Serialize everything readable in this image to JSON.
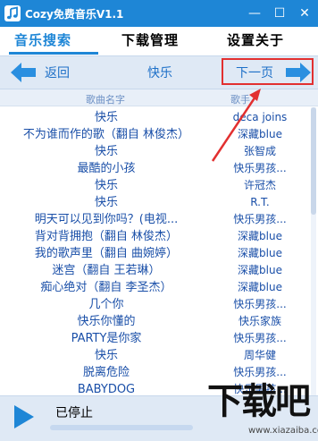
{
  "window": {
    "title": "Cozy免费音乐V1.1",
    "minimize_label": "—",
    "maximize_label": "☐",
    "close_label": "✕"
  },
  "tabs": [
    {
      "label": "音乐搜索",
      "active": true
    },
    {
      "label": "下载管理",
      "active": false
    },
    {
      "label": "设置关于",
      "active": false
    }
  ],
  "nav": {
    "back_label": "返回",
    "title": "快乐",
    "next_label": "下一页"
  },
  "list": {
    "headers": {
      "song": "歌曲名字",
      "artist": "歌手"
    },
    "rows": [
      {
        "song": "快乐",
        "artist": "deca joins"
      },
      {
        "song": "不为谁而作的歌（翻自 林俊杰）",
        "artist": "深藏blue"
      },
      {
        "song": "快乐",
        "artist": "张智成"
      },
      {
        "song": "最酷的小孩",
        "artist": "快乐男孩..."
      },
      {
        "song": "快乐",
        "artist": "许冠杰"
      },
      {
        "song": "快乐",
        "artist": "R.T."
      },
      {
        "song": "明天可以见到你吗？(电视...",
        "artist": "快乐男孩..."
      },
      {
        "song": "背对背拥抱（翻自 林俊杰）",
        "artist": "深藏blue"
      },
      {
        "song": "我的歌声里（翻自 曲婉婷）",
        "artist": "深藏blue"
      },
      {
        "song": "迷宫（翻自 王若琳）",
        "artist": "深藏blue"
      },
      {
        "song": "痴心绝对（翻自 李圣杰）",
        "artist": "深藏blue"
      },
      {
        "song": "几个你",
        "artist": "快乐男孩..."
      },
      {
        "song": "快乐你懂的",
        "artist": "快乐家族"
      },
      {
        "song": "PARTY是你家",
        "artist": "快乐男孩..."
      },
      {
        "song": "快乐",
        "artist": "周华健"
      },
      {
        "song": "脱离危险",
        "artist": "快乐男孩..."
      },
      {
        "song": "BABYDOG",
        "artist": "快乐男孩..."
      }
    ]
  },
  "player": {
    "status": "已停止",
    "progress": 0
  },
  "watermark": {
    "chars": "下载吧",
    "url": "www.xiazaiba.com"
  },
  "colors": {
    "titlebar": "#1e86d6",
    "accent": "#1e86d6",
    "annotation": "#e23030"
  }
}
